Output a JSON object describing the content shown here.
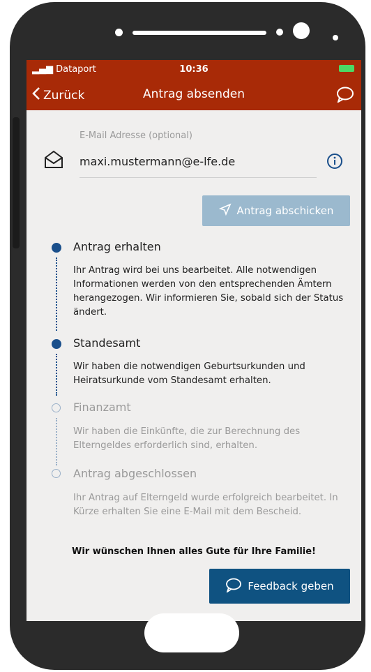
{
  "status_bar": {
    "carrier": "Dataport",
    "time": "10:36"
  },
  "nav": {
    "back_label": "Zurück",
    "title": "Antrag absenden"
  },
  "email": {
    "label": "E-Mail Adresse (optional)",
    "value": "maxi.mustermann@e-lfe.de"
  },
  "send_button": {
    "label": "Antrag abschicken"
  },
  "steps": [
    {
      "title": "Antrag erhalten",
      "status": "done",
      "description": "Ihr Antrag wird bei uns bearbeitet. Alle notwendigen Informationen werden von den entsprechenden Ämtern herangezogen. Wir informieren Sie, sobald sich der Status ändert."
    },
    {
      "title": "Standesamt",
      "status": "done",
      "description": "Wir haben die notwendigen Geburtsurkunden und Heiratsurkunde vom Standesamt erhalten."
    },
    {
      "title": "Finanzamt",
      "status": "pending",
      "description": "Wir haben die Einkünfte, die zur Berechnung des Elterngeldes erforderlich sind, erhalten."
    },
    {
      "title": "Antrag abgeschlossen",
      "status": "pending",
      "description": "Ihr Antrag auf Elterngeld wurde erfolgreich bearbeitet. In Kürze erhalten Sie eine E-Mail mit dem Bescheid."
    }
  ],
  "closing_message": "Wir wünschen Ihnen alles Gute für Ihre Familie!",
  "feedback_button": {
    "label": "Feedback geben"
  },
  "colors": {
    "header": "#a82a07",
    "primary": "#0f5281",
    "disabled_button": "#9bb9ce",
    "step_done": "#1a4f8b"
  }
}
